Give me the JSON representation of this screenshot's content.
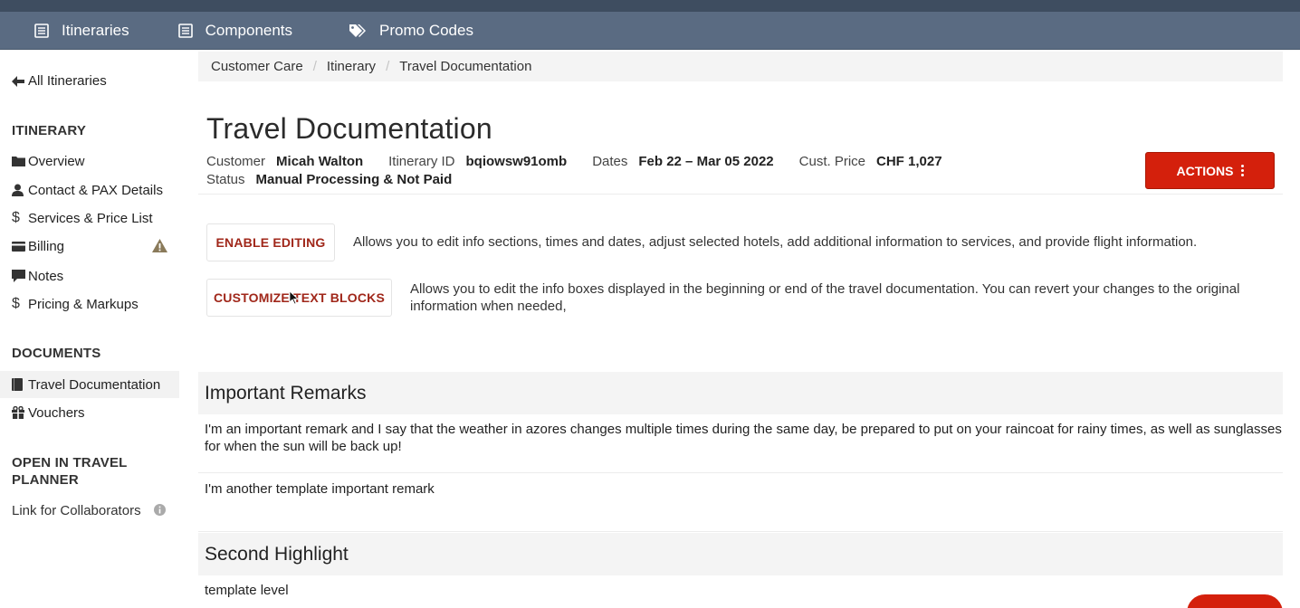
{
  "topnav": {
    "items": [
      {
        "label": "Itineraries",
        "icon": "list-icon"
      },
      {
        "label": "Components",
        "icon": "list-icon"
      },
      {
        "label": "Promo Codes",
        "icon": "tags-icon"
      }
    ]
  },
  "sidebar": {
    "back_label": "All Itineraries",
    "itinerary_heading": "ITINERARY",
    "itinerary_items": [
      {
        "label": "Overview",
        "icon": "folder-icon"
      },
      {
        "label": "Contact & PAX Details",
        "icon": "user-icon"
      },
      {
        "label": "Services & Price List",
        "icon": "dollar-icon"
      },
      {
        "label": "Billing",
        "icon": "credit-card-icon"
      },
      {
        "label": "Notes",
        "icon": "comment-icon"
      },
      {
        "label": "Pricing & Markups",
        "icon": "dollar-icon"
      }
    ],
    "documents_heading": "DOCUMENTS",
    "document_items": [
      {
        "label": "Travel Documentation",
        "icon": "book-icon"
      },
      {
        "label": "Vouchers",
        "icon": "gift-icon"
      }
    ],
    "planner_heading": "OPEN IN TRAVEL PLANNER",
    "planner_items": [
      {
        "label": "Link for Collaborators",
        "icon": "info-icon"
      }
    ]
  },
  "breadcrumb": [
    "Customer Care",
    "Itinerary",
    "Travel Documentation"
  ],
  "page": {
    "title": "Travel Documentation",
    "customer_label": "Customer",
    "customer": "Micah Walton",
    "itinerary_id_label": "Itinerary ID",
    "itinerary_id": "bqiowsw91omb",
    "dates_label": "Dates",
    "dates": "Feb 22 – Mar 05 2022",
    "price_label": "Cust. Price",
    "price": "CHF 1,027",
    "status_label": "Status",
    "status": "Manual Processing & Not Paid",
    "actions_label": "ACTIONS"
  },
  "options": [
    {
      "button": "ENABLE EDITING",
      "description": "Allows you to edit info sections, times and dates, adjust selected hotels, add additional information to services, and provide flight information."
    },
    {
      "button": "CUSTOMIZE TEXT BLOCKS",
      "description": "Allows you to edit the info boxes displayed in the beginning or end of the travel documentation. You can revert your changes to the original information when needed,"
    }
  ],
  "sections": [
    {
      "title": "Important Remarks",
      "remarks": [
        "I'm an important remark and I say that the weather in azores changes multiple times during the same day, be prepared to put on your raincoat for rainy times, as well as sunglasses for when the sun will be back up!",
        "I'm another template important remark"
      ]
    },
    {
      "title": "Second Highlight",
      "remarks": [
        "template level"
      ]
    }
  ],
  "colors": {
    "nav_bg": "#5a6b82",
    "accent_red": "#d4200c",
    "button_text_red": "#a0271a"
  }
}
